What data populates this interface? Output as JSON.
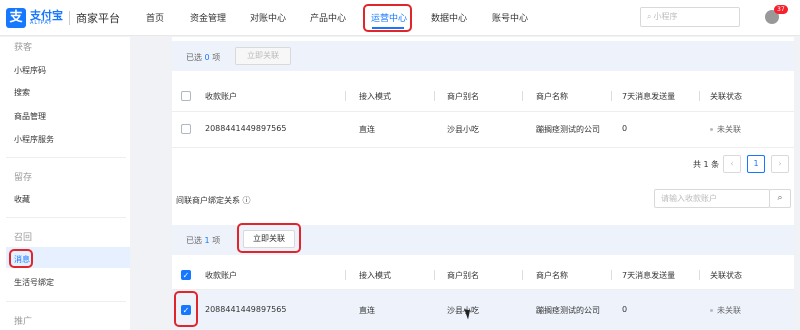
{
  "header": {
    "logo_cn": "支付宝",
    "logo_en": "ALIPAY",
    "platform": "商家平台",
    "nav": [
      "首页",
      "资金管理",
      "对账中心",
      "产品中心",
      "运营中心",
      "数据中心",
      "账号中心"
    ],
    "active_nav": "运营中心",
    "search_placeholder": "小程序",
    "notification_count": "37",
    "accent_color": "#1677ff"
  },
  "sidebar": {
    "group1": "获客",
    "group1_items": [
      "小程序码",
      "搜索",
      "商品管理",
      "小程序服务"
    ],
    "group2": "留存",
    "group2_items": [
      "收藏"
    ],
    "group3": "召回",
    "group3_items": [
      "消息",
      "生活号绑定"
    ],
    "active_item": "消息",
    "group4": "推广"
  },
  "section1": {
    "selected_prefix": "已选",
    "selected_count": "0",
    "selected_suffix": "项",
    "bind_button": "立即关联",
    "columns": [
      "收款账户",
      "接入模式",
      "商户别名",
      "商户名称",
      "7天消息发送量",
      "关联状态"
    ],
    "rows": [
      {
        "account": "2088441449897565",
        "mode": "直连",
        "alias": "沙县小吃",
        "name": "蹦搁痉测试的公司",
        "count": "0",
        "status": "未关联"
      }
    ],
    "pagination": {
      "total": "共 1 条",
      "current": "1"
    }
  },
  "section2": {
    "title": "间联商户绑定关系",
    "help_icon": "info-circle-icon",
    "search_placeholder": "请输入收款账户",
    "selected_prefix": "已选",
    "selected_count": "1",
    "selected_suffix": "项",
    "bind_button": "立即关联",
    "columns": [
      "收款账户",
      "接入模式",
      "商户别名",
      "商户名称",
      "7天消息发送量",
      "关联状态"
    ],
    "rows": [
      {
        "account": "2088441449897565",
        "mode": "直连",
        "alias": "沙县小吃",
        "name": "蹦搁痉测试的公司",
        "count": "0",
        "status": "未关联"
      }
    ]
  }
}
